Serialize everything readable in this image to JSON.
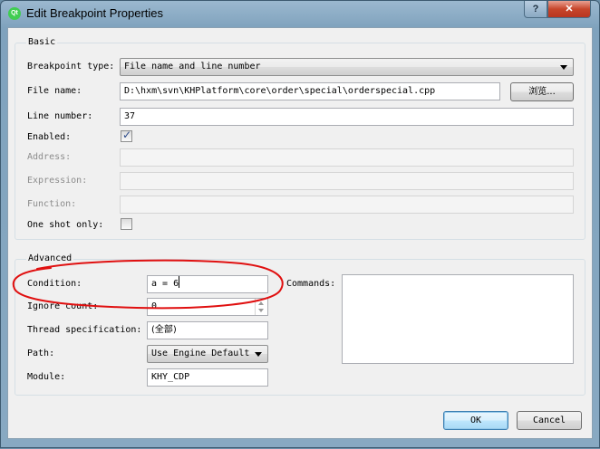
{
  "window": {
    "title": "Edit Breakpoint Properties",
    "app_icon_text": "Qt",
    "help_symbol": "?",
    "close_symbol": "✕"
  },
  "basic": {
    "title": "Basic",
    "breakpoint_type": {
      "label": "Breakpoint type:",
      "value": "File name and line number"
    },
    "file_name": {
      "label": "File name:",
      "value": "D:\\hxm\\svn\\KHPlatform\\core\\order\\special\\orderspecial.cpp",
      "browse_label": "浏览..."
    },
    "line_number": {
      "label": "Line number:",
      "value": "37"
    },
    "enabled": {
      "label": "Enabled:",
      "checked": true
    },
    "address": {
      "label": "Address:",
      "value": ""
    },
    "expression": {
      "label": "Expression:",
      "value": ""
    },
    "function": {
      "label": "Function:",
      "value": ""
    },
    "one_shot": {
      "label": "One shot only:",
      "checked": false
    }
  },
  "advanced": {
    "title": "Advanced",
    "condition": {
      "label": "Condition:",
      "value": "a = 6"
    },
    "commands": {
      "label": "Commands:",
      "value": ""
    },
    "ignore_count": {
      "label": "Ignore count:",
      "value": "0"
    },
    "thread_spec": {
      "label": "Thread specification:",
      "value": "(全部)"
    },
    "path": {
      "label": "Path:",
      "value": "Use Engine Default"
    },
    "module": {
      "label": "Module:",
      "value": "KHY_CDP"
    }
  },
  "buttons": {
    "ok": "OK",
    "cancel": "Cancel"
  },
  "colors": {
    "annotation_circle": "#e01010",
    "title_bar": "#88a9c2",
    "dialog_bg": "#f0f0f0"
  }
}
